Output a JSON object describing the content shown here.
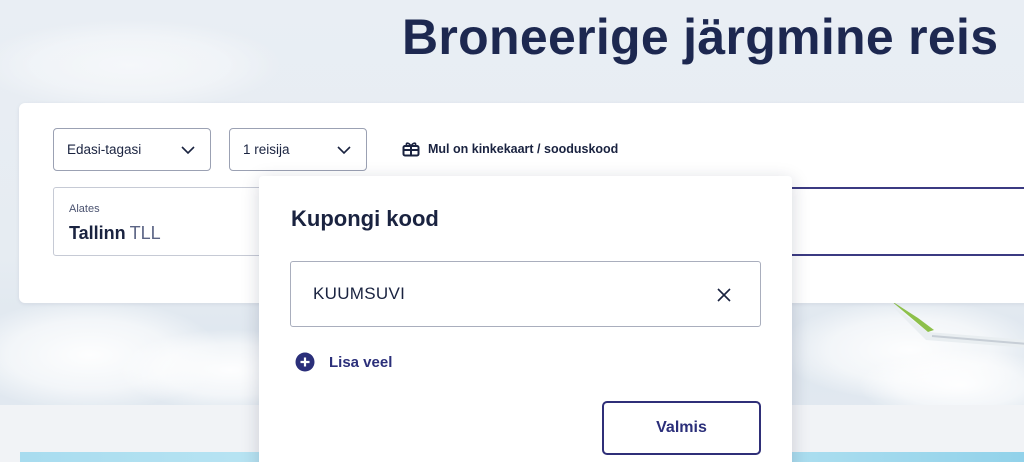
{
  "hero": {
    "title": "Broneerige järgmine reis"
  },
  "search": {
    "trip_type": {
      "selected": "Edasi-tagasi",
      "icon": "chevron-down-icon"
    },
    "passengers": {
      "selected": "1 reisija",
      "icon": "chevron-down-icon"
    },
    "gift_link": {
      "label": "Mul on kinkekaart / sooduskood",
      "icon": "gift-icon"
    },
    "from": {
      "label": "Alates",
      "city": "Tallinn",
      "code": "TLL"
    }
  },
  "coupon_popup": {
    "title": "Kupongi kood",
    "input_value": "KUUMSUVI",
    "clear_icon": "close-icon",
    "add_more_label": "Lisa veel",
    "add_more_icon": "plus-circle-icon",
    "done_label": "Valmis"
  },
  "colors": {
    "brand_navy": "#1d2850",
    "accent_indigo": "#2b2f7a",
    "border": "#9ba1b3"
  }
}
